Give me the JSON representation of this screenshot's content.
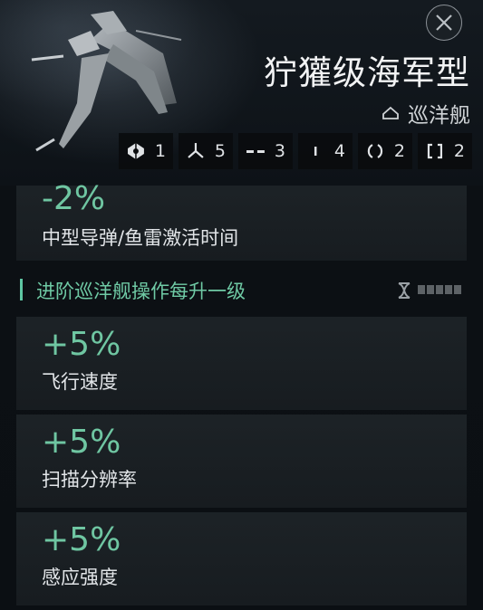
{
  "header": {
    "ship_name": "狞獾级海军型",
    "ship_class": "巡洋舰"
  },
  "stats": [
    {
      "icon": "turret-hardpoint-icon",
      "value": "1"
    },
    {
      "icon": "launcher-hardpoint-icon",
      "value": "5"
    },
    {
      "icon": "high-slot-icon",
      "value": "3"
    },
    {
      "icon": "mid-slot-icon",
      "value": "4"
    },
    {
      "icon": "low-slot-icon",
      "value": "2"
    },
    {
      "icon": "rig-slot-icon",
      "value": "2"
    }
  ],
  "bonuses_top": [
    {
      "value": "-2%",
      "label": "中型导弹/鱼雷激活时间"
    }
  ],
  "skill_section": {
    "title": "进阶巡洋舰操作每升一级",
    "icon": "skill-book-icon",
    "levels_trained": 0,
    "levels_total": 5,
    "bonuses": [
      {
        "value": "+5%",
        "label": "飞行速度"
      },
      {
        "value": "+5%",
        "label": "扫描分辨率"
      },
      {
        "value": "+5%",
        "label": "感应强度"
      }
    ]
  },
  "colors": {
    "accent_green": "#6fc6a2",
    "card_bg": "#1e2428",
    "background": "#0a0e12"
  }
}
